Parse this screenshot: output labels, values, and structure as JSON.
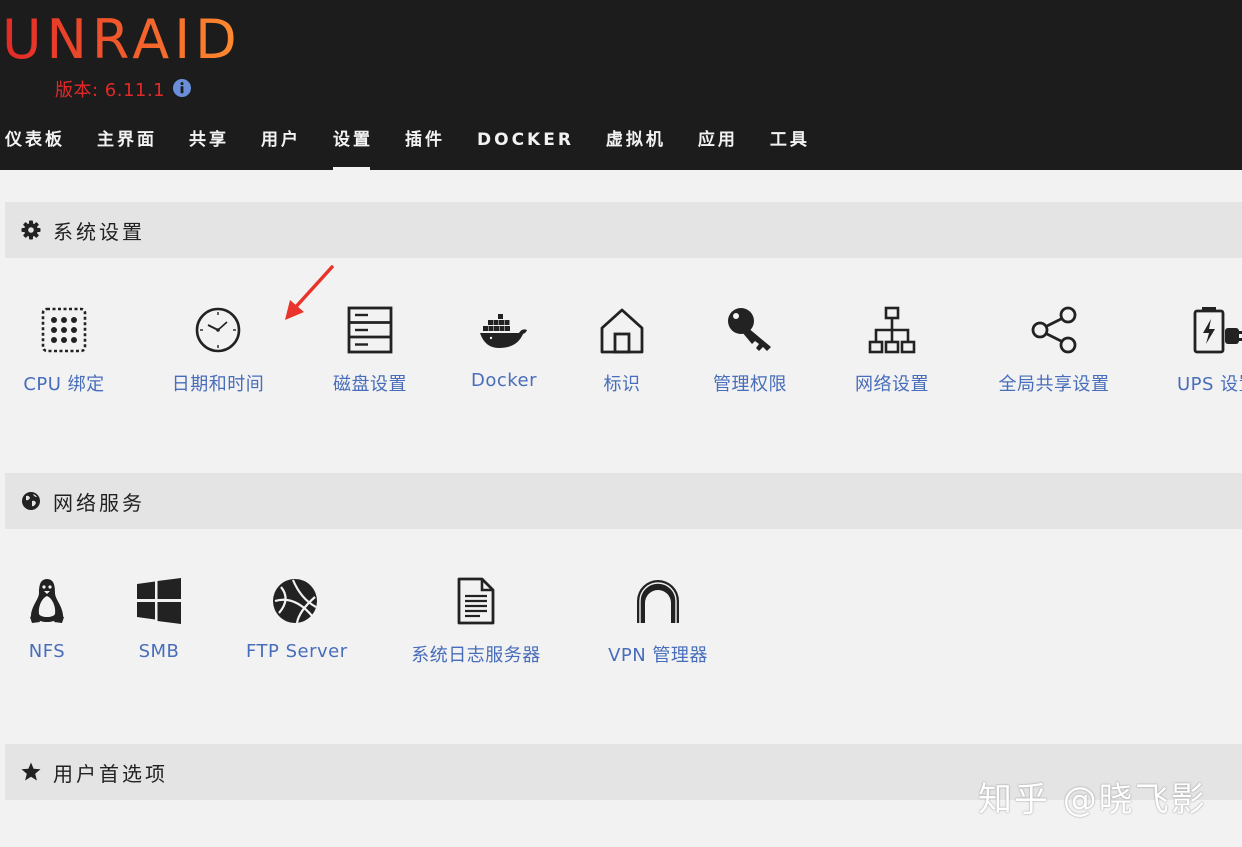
{
  "brand": {
    "logo_text": "UNRAID",
    "version_text": "版本: 6.11.1",
    "logo_gradient": [
      "#e22828",
      "#ff8c2f"
    ]
  },
  "nav": {
    "items": [
      {
        "label": "仪表板"
      },
      {
        "label": "主界面"
      },
      {
        "label": "共享"
      },
      {
        "label": "用户"
      },
      {
        "label": "设置",
        "active": true
      },
      {
        "label": "插件"
      },
      {
        "label": "DOCKER"
      },
      {
        "label": "虚拟机"
      },
      {
        "label": "应用"
      },
      {
        "label": "工具"
      }
    ]
  },
  "sections": {
    "system": {
      "title": "系统设置",
      "icon": "gear-icon",
      "items": [
        {
          "label": "CPU 绑定",
          "icon": "cpu-icon"
        },
        {
          "label": "日期和时间",
          "icon": "clock-icon"
        },
        {
          "label": "磁盘设置",
          "icon": "server-icon"
        },
        {
          "label": "Docker",
          "icon": "docker-icon"
        },
        {
          "label": "标识",
          "icon": "home-icon"
        },
        {
          "label": "管理权限",
          "icon": "key-icon"
        },
        {
          "label": "网络设置",
          "icon": "sitemap-icon"
        },
        {
          "label": "全局共享设置",
          "icon": "share-icon"
        },
        {
          "label": "UPS 设置",
          "icon": "battery-icon"
        }
      ]
    },
    "network": {
      "title": "网络服务",
      "icon": "globe-icon",
      "items": [
        {
          "label": "NFS",
          "icon": "linux-icon"
        },
        {
          "label": "SMB",
          "icon": "windows-icon"
        },
        {
          "label": "FTP Server",
          "icon": "ftp-globe-icon"
        },
        {
          "label": "系统日志服务器",
          "icon": "document-icon"
        },
        {
          "label": "VPN 管理器",
          "icon": "tunnel-icon"
        }
      ]
    },
    "user_prefs": {
      "title": "用户首选项",
      "icon": "star-icon"
    }
  },
  "annotation": {
    "color": "#e8342a"
  },
  "watermark": {
    "text": "知乎 @晓飞影"
  },
  "colors": {
    "header_bg": "#1c1c1c",
    "link": "#486dba",
    "page_bg": "#f2f2f2",
    "section_bg": "#e4e4e4"
  }
}
